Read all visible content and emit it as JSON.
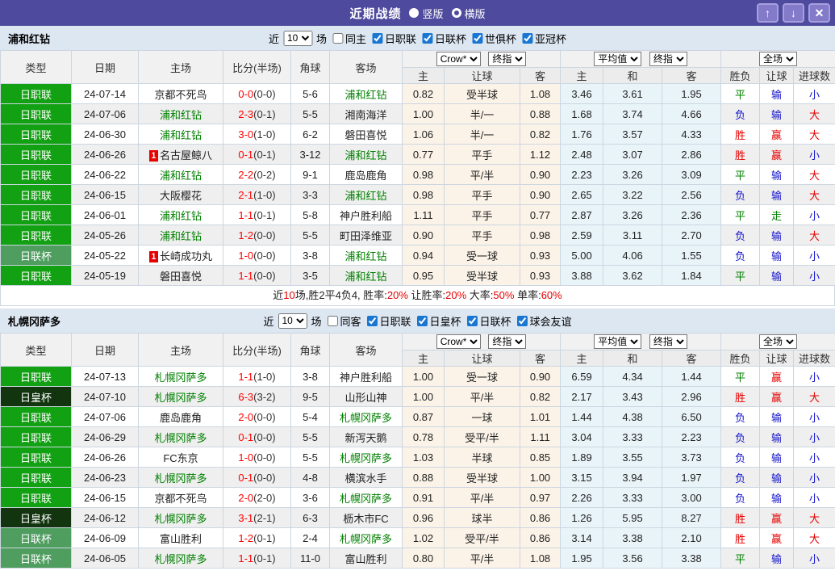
{
  "titlebar": {
    "title": "近期战绩",
    "radios": [
      {
        "label": "竖版",
        "selected": true
      },
      {
        "label": "横版",
        "selected": false
      }
    ],
    "buttons": [
      {
        "name": "move-up-button",
        "glyph": "↑"
      },
      {
        "name": "move-down-button",
        "glyph": "↓"
      },
      {
        "name": "close-button",
        "glyph": "✕"
      }
    ]
  },
  "header_labels": {
    "type": "类型",
    "date": "日期",
    "home": "主场",
    "score": "比分(半场)",
    "corners": "角球",
    "away": "客场",
    "odds_home": "主",
    "odds_handicap": "让球",
    "odds_away": "客",
    "avg_home": "主",
    "avg_draw": "和",
    "avg_away": "客",
    "result": "胜负",
    "handicap_result": "让球",
    "goals": "进球数",
    "dd_bookmaker": "Crow*",
    "dd_final_1": "终指",
    "dd_average": "平均值",
    "dd_final_2": "终指",
    "dd_fullmatch": "全场"
  },
  "filters_common": {
    "near_label": "近",
    "matches_label": "场",
    "near_value": "10"
  },
  "colors": {
    "titlebar_bg": "#4e4a9d",
    "league_colors": {
      "日职联": "#12a112",
      "日联杯": "#4f9d5f",
      "日皇杯": "#123510"
    },
    "subject_team_green": "#008000",
    "score_red": "#ff0000",
    "win_red": "#e60000",
    "lose_blue": "#1414cc",
    "draw_green": "#008000",
    "odds_bg": "#fbf3e8",
    "avg_bg": "#e9f4f9"
  },
  "sections": [
    {
      "team": "浦和红钻",
      "same_venue_label": "同主",
      "league_checkboxes": [
        "日职联",
        "日联杯",
        "世俱杯",
        "亚冠杯"
      ],
      "rows": [
        {
          "league": "日职联",
          "date": "24-07-14",
          "home": "京都不死鸟",
          "home_green": false,
          "home_badge": "",
          "score": "0-0",
          "half": "(0-0)",
          "corners": "5-6",
          "away": "浦和红钻",
          "away_green": true,
          "odds": [
            "0.82",
            "受半球",
            "1.08"
          ],
          "avg": [
            "3.46",
            "3.61",
            "1.95"
          ],
          "outcome": [
            "平",
            "输",
            "小"
          ]
        },
        {
          "league": "日职联",
          "date": "24-07-06",
          "home": "浦和红钻",
          "home_green": true,
          "home_badge": "",
          "score": "2-3",
          "half": "(0-1)",
          "corners": "5-5",
          "away": "湘南海洋",
          "away_green": false,
          "odds": [
            "1.00",
            "半/一",
            "0.88"
          ],
          "avg": [
            "1.68",
            "3.74",
            "4.66"
          ],
          "outcome": [
            "负",
            "输",
            "大"
          ]
        },
        {
          "league": "日职联",
          "date": "24-06-30",
          "home": "浦和红钻",
          "home_green": true,
          "home_badge": "",
          "score": "3-0",
          "half": "(1-0)",
          "corners": "6-2",
          "away": "磐田喜悦",
          "away_green": false,
          "odds": [
            "1.06",
            "半/一",
            "0.82"
          ],
          "avg": [
            "1.76",
            "3.57",
            "4.33"
          ],
          "outcome": [
            "胜",
            "赢",
            "大"
          ]
        },
        {
          "league": "日职联",
          "date": "24-06-26",
          "home": "名古屋鲸八",
          "home_green": false,
          "home_badge": "1",
          "score": "0-1",
          "half": "(0-1)",
          "corners": "3-12",
          "away": "浦和红钻",
          "away_green": true,
          "odds": [
            "0.77",
            "平手",
            "1.12"
          ],
          "avg": [
            "2.48",
            "3.07",
            "2.86"
          ],
          "outcome": [
            "胜",
            "赢",
            "小"
          ]
        },
        {
          "league": "日职联",
          "date": "24-06-22",
          "home": "浦和红钻",
          "home_green": true,
          "home_badge": "",
          "score": "2-2",
          "half": "(0-2)",
          "corners": "9-1",
          "away": "鹿岛鹿角",
          "away_green": false,
          "odds": [
            "0.98",
            "平/半",
            "0.90"
          ],
          "avg": [
            "2.23",
            "3.26",
            "3.09"
          ],
          "outcome": [
            "平",
            "输",
            "大"
          ]
        },
        {
          "league": "日职联",
          "date": "24-06-15",
          "home": "大阪樱花",
          "home_green": false,
          "home_badge": "",
          "score": "2-1",
          "half": "(1-0)",
          "corners": "3-3",
          "away": "浦和红钻",
          "away_green": true,
          "odds": [
            "0.98",
            "平手",
            "0.90"
          ],
          "avg": [
            "2.65",
            "3.22",
            "2.56"
          ],
          "outcome": [
            "负",
            "输",
            "大"
          ]
        },
        {
          "league": "日职联",
          "date": "24-06-01",
          "home": "浦和红钻",
          "home_green": true,
          "home_badge": "",
          "score": "1-1",
          "half": "(0-1)",
          "corners": "5-8",
          "away": "神户胜利船",
          "away_green": false,
          "odds": [
            "1.11",
            "平手",
            "0.77"
          ],
          "avg": [
            "2.87",
            "3.26",
            "2.36"
          ],
          "outcome": [
            "平",
            "走",
            "小"
          ]
        },
        {
          "league": "日职联",
          "date": "24-05-26",
          "home": "浦和红钻",
          "home_green": true,
          "home_badge": "",
          "score": "1-2",
          "half": "(0-0)",
          "corners": "5-5",
          "away": "町田泽维亚",
          "away_green": false,
          "odds": [
            "0.90",
            "平手",
            "0.98"
          ],
          "avg": [
            "2.59",
            "3.11",
            "2.70"
          ],
          "outcome": [
            "负",
            "输",
            "大"
          ]
        },
        {
          "league": "日联杯",
          "date": "24-05-22",
          "home": "长崎成功丸",
          "home_green": false,
          "home_badge": "1",
          "score": "1-0",
          "half": "(0-0)",
          "corners": "3-8",
          "away": "浦和红钻",
          "away_green": true,
          "odds": [
            "0.94",
            "受一球",
            "0.93"
          ],
          "avg": [
            "5.00",
            "4.06",
            "1.55"
          ],
          "outcome": [
            "负",
            "输",
            "小"
          ]
        },
        {
          "league": "日职联",
          "date": "24-05-19",
          "home": "磐田喜悦",
          "home_green": false,
          "home_badge": "",
          "score": "1-1",
          "half": "(0-0)",
          "corners": "3-5",
          "away": "浦和红钻",
          "away_green": true,
          "odds": [
            "0.95",
            "受半球",
            "0.93"
          ],
          "avg": [
            "3.88",
            "3.62",
            "1.84"
          ],
          "outcome": [
            "平",
            "输",
            "小"
          ]
        }
      ],
      "summary_segments": [
        {
          "t": "近",
          "c": "d"
        },
        {
          "t": "10",
          "c": "r"
        },
        {
          "t": "场,胜2平4负4, 胜率:",
          "c": "d"
        },
        {
          "t": "20%",
          "c": "r"
        },
        {
          "t": " 让胜率:",
          "c": "d"
        },
        {
          "t": "20%",
          "c": "r"
        },
        {
          "t": " 大率:",
          "c": "d"
        },
        {
          "t": "50%",
          "c": "r"
        },
        {
          "t": " 单率:",
          "c": "d"
        },
        {
          "t": "60%",
          "c": "r"
        }
      ]
    },
    {
      "team": "札幌冈萨多",
      "same_venue_label": "同客",
      "league_checkboxes": [
        "日职联",
        "日皇杯",
        "日联杯",
        "球会友谊"
      ],
      "rows": [
        {
          "league": "日职联",
          "date": "24-07-13",
          "home": "札幌冈萨多",
          "home_green": true,
          "home_badge": "",
          "score": "1-1",
          "half": "(1-0)",
          "corners": "3-8",
          "away": "神户胜利船",
          "away_green": false,
          "odds": [
            "1.00",
            "受一球",
            "0.90"
          ],
          "avg": [
            "6.59",
            "4.34",
            "1.44"
          ],
          "outcome": [
            "平",
            "赢",
            "小"
          ]
        },
        {
          "league": "日皇杯",
          "date": "24-07-10",
          "home": "札幌冈萨多",
          "home_green": true,
          "home_badge": "",
          "score": "6-3",
          "half": "(3-2)",
          "corners": "9-5",
          "away": "山形山神",
          "away_green": false,
          "odds": [
            "1.00",
            "平/半",
            "0.82"
          ],
          "avg": [
            "2.17",
            "3.43",
            "2.96"
          ],
          "outcome": [
            "胜",
            "赢",
            "大"
          ]
        },
        {
          "league": "日职联",
          "date": "24-07-06",
          "home": "鹿岛鹿角",
          "home_green": false,
          "home_badge": "",
          "score": "2-0",
          "half": "(0-0)",
          "corners": "5-4",
          "away": "札幌冈萨多",
          "away_green": true,
          "odds": [
            "0.87",
            "一球",
            "1.01"
          ],
          "avg": [
            "1.44",
            "4.38",
            "6.50"
          ],
          "outcome": [
            "负",
            "输",
            "小"
          ]
        },
        {
          "league": "日职联",
          "date": "24-06-29",
          "home": "札幌冈萨多",
          "home_green": true,
          "home_badge": "",
          "score": "0-1",
          "half": "(0-0)",
          "corners": "5-5",
          "away": "新泻天鹅",
          "away_green": false,
          "odds": [
            "0.78",
            "受平/半",
            "1.11"
          ],
          "avg": [
            "3.04",
            "3.33",
            "2.23"
          ],
          "outcome": [
            "负",
            "输",
            "小"
          ]
        },
        {
          "league": "日职联",
          "date": "24-06-26",
          "home": "FC东京",
          "home_green": false,
          "home_badge": "",
          "score": "1-0",
          "half": "(0-0)",
          "corners": "5-5",
          "away": "札幌冈萨多",
          "away_green": true,
          "odds": [
            "1.03",
            "半球",
            "0.85"
          ],
          "avg": [
            "1.89",
            "3.55",
            "3.73"
          ],
          "outcome": [
            "负",
            "输",
            "小"
          ]
        },
        {
          "league": "日职联",
          "date": "24-06-23",
          "home": "札幌冈萨多",
          "home_green": true,
          "home_badge": "",
          "score": "0-1",
          "half": "(0-0)",
          "corners": "4-8",
          "away": "横滨水手",
          "away_green": false,
          "odds": [
            "0.88",
            "受半球",
            "1.00"
          ],
          "avg": [
            "3.15",
            "3.94",
            "1.97"
          ],
          "outcome": [
            "负",
            "输",
            "小"
          ]
        },
        {
          "league": "日职联",
          "date": "24-06-15",
          "home": "京都不死鸟",
          "home_green": false,
          "home_badge": "",
          "score": "2-0",
          "half": "(2-0)",
          "corners": "3-6",
          "away": "札幌冈萨多",
          "away_green": true,
          "odds": [
            "0.91",
            "平/半",
            "0.97"
          ],
          "avg": [
            "2.26",
            "3.33",
            "3.00"
          ],
          "outcome": [
            "负",
            "输",
            "小"
          ]
        },
        {
          "league": "日皇杯",
          "date": "24-06-12",
          "home": "札幌冈萨多",
          "home_green": true,
          "home_badge": "",
          "score": "3-1",
          "half": "(2-1)",
          "corners": "6-3",
          "away": "枥木市FC",
          "away_green": false,
          "odds": [
            "0.96",
            "球半",
            "0.86"
          ],
          "avg": [
            "1.26",
            "5.95",
            "8.27"
          ],
          "outcome": [
            "胜",
            "赢",
            "大"
          ]
        },
        {
          "league": "日联杯",
          "date": "24-06-09",
          "home": "富山胜利",
          "home_green": false,
          "home_badge": "",
          "score": "1-2",
          "half": "(0-1)",
          "corners": "2-4",
          "away": "札幌冈萨多",
          "away_green": true,
          "odds": [
            "1.02",
            "受平/半",
            "0.86"
          ],
          "avg": [
            "3.14",
            "3.38",
            "2.10"
          ],
          "outcome": [
            "胜",
            "赢",
            "大"
          ]
        },
        {
          "league": "日联杯",
          "date": "24-06-05",
          "home": "札幌冈萨多",
          "home_green": true,
          "home_badge": "",
          "score": "1-1",
          "half": "(0-1)",
          "corners": "11-0",
          "away": "富山胜利",
          "away_green": false,
          "odds": [
            "0.80",
            "平/半",
            "1.08"
          ],
          "avg": [
            "1.95",
            "3.56",
            "3.38"
          ],
          "outcome": [
            "平",
            "输",
            "小"
          ]
        }
      ],
      "summary_segments": []
    }
  ]
}
